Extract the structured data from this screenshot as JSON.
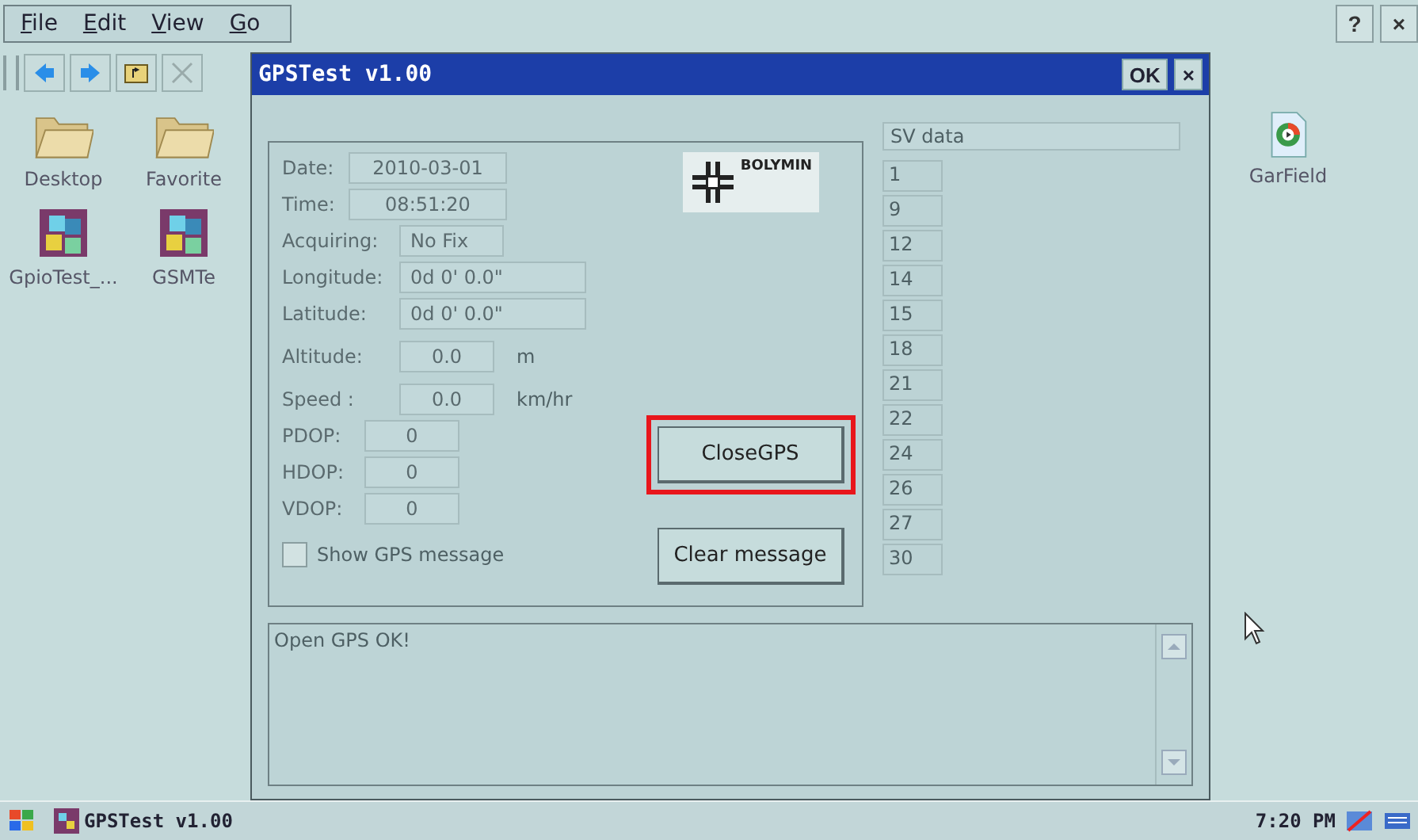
{
  "menu": [
    {
      "label": "File"
    },
    {
      "label": "Edit"
    },
    {
      "label": "View"
    },
    {
      "label": "Go"
    }
  ],
  "top_buttons": [
    "?",
    "×"
  ],
  "desktop_icons": [
    {
      "label": "Desktop",
      "kind": "folder"
    },
    {
      "label": "Favorite",
      "kind": "folder"
    },
    {
      "label": "GpioTest_...",
      "kind": "app"
    },
    {
      "label": "GSMTe",
      "kind": "app"
    }
  ],
  "right_icons": [
    {
      "label": "GarField",
      "kind": "media"
    }
  ],
  "dialog": {
    "title": "GPSTest v1.00",
    "ok": "OK",
    "close": "×",
    "fields": [
      {
        "label": "Date:",
        "value": "2010-03-01",
        "kind": "stamp"
      },
      {
        "label": "Time:",
        "value": "08:51:20",
        "kind": "stamp"
      },
      {
        "label": "Acquiring:",
        "value": "No Fix",
        "kind": "status"
      },
      {
        "label": "Longitude:",
        "value": "0d 0' 0.0\"",
        "kind": "coord"
      },
      {
        "label": "Latitude:",
        "value": "0d 0' 0.0\"",
        "kind": "coord"
      },
      {
        "label": "Altitude:",
        "value": "0.0",
        "unit": "m",
        "kind": "measure"
      },
      {
        "label": "Speed :",
        "value": "0.0",
        "unit": "km/hr",
        "kind": "measure"
      },
      {
        "label": "PDOP:",
        "value": "0",
        "kind": "dop"
      },
      {
        "label": "HDOP:",
        "value": "0",
        "kind": "dop"
      },
      {
        "label": "VDOP:",
        "value": "0",
        "kind": "dop"
      }
    ],
    "show_message": {
      "label": "Show GPS message",
      "checked": false
    },
    "logo": "BOLYMIN",
    "buttons": [
      {
        "label": "CloseGPS",
        "highlighted": true
      },
      {
        "label": "Clear message",
        "highlighted": false
      }
    ],
    "sv_header": "SV data",
    "sv_items": [
      "1",
      "9",
      "12",
      "14",
      "15",
      "18",
      "21",
      "22",
      "24",
      "26",
      "27",
      "30"
    ],
    "message": "Open GPS OK!"
  },
  "taskbar": {
    "task": "GPSTest v1.00",
    "time": "7:20 PM"
  }
}
